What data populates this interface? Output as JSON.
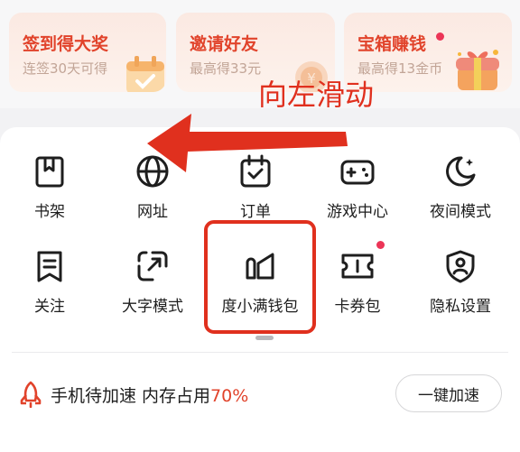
{
  "promos": [
    {
      "title": "签到得大奖",
      "subtitle": "连签30天可得"
    },
    {
      "title": "邀请好友",
      "subtitle": "最高得33元"
    },
    {
      "title": "宝箱赚钱",
      "subtitle": "最高得13金币"
    }
  ],
  "grid": {
    "row1": [
      {
        "label": "书架",
        "icon": "bookmark-book-icon"
      },
      {
        "label": "网址",
        "icon": "globe-icon"
      },
      {
        "label": "订单",
        "icon": "calendar-check-icon"
      },
      {
        "label": "游戏中心",
        "icon": "gamepad-icon"
      },
      {
        "label": "夜间模式",
        "icon": "moon-icon"
      }
    ],
    "row2": [
      {
        "label": "关注",
        "icon": "bookmark-list-icon"
      },
      {
        "label": "大字模式",
        "icon": "expand-icon"
      },
      {
        "label": "度小满钱包",
        "icon": "wallet-icon"
      },
      {
        "label": "卡券包",
        "icon": "ticket-icon"
      },
      {
        "label": "隐私设置",
        "icon": "shield-user-icon"
      }
    ]
  },
  "accelerate": {
    "text": "手机待加速 内存占用",
    "percent": "70%",
    "button": "一键加速",
    "icon": "rocket-icon"
  },
  "annotation": {
    "text": "向左滑动"
  },
  "colors": {
    "accent": "#e1432b",
    "annotation": "#e0301e",
    "badge": "#ec3557"
  }
}
